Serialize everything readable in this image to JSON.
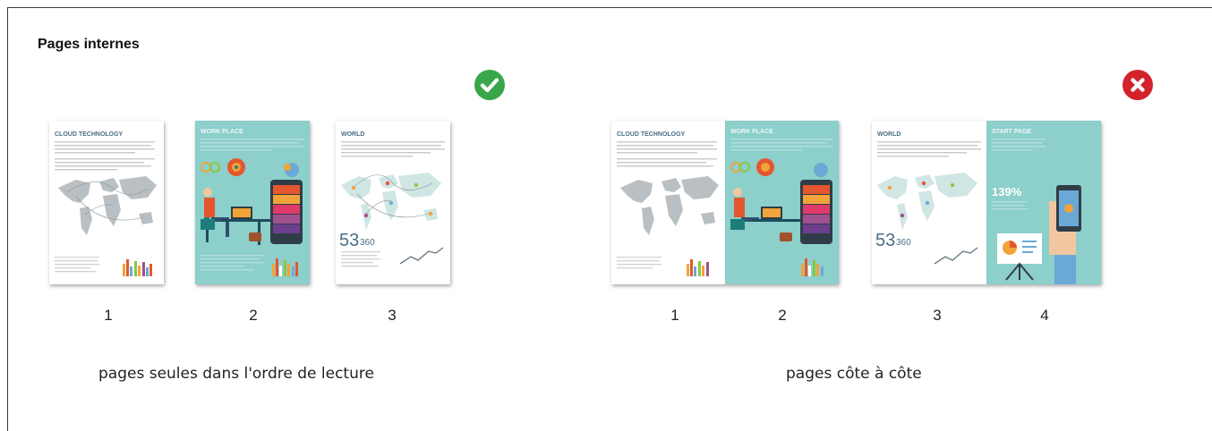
{
  "section": {
    "title": "Pages internes"
  },
  "good_example": {
    "icon": "check-circle-icon",
    "icon_color": "#3aa64a",
    "pages": [
      {
        "number": "1",
        "title": "CLOUD TECHNOLOGY"
      },
      {
        "number": "2",
        "title": "WORK PLACE"
      },
      {
        "number": "3",
        "title": "WORLD",
        "stat": "53",
        "stat_sub": "360"
      }
    ],
    "caption": "pages seules dans l'ordre de lecture"
  },
  "bad_example": {
    "icon": "cross-circle-icon",
    "icon_color": "#d3222a",
    "pages": [
      {
        "number": "1",
        "title": "CLOUD TECHNOLOGY"
      },
      {
        "number": "2",
        "title": "WORK PLACE"
      },
      {
        "number": "3",
        "title": "WORLD",
        "stat": "53",
        "stat_sub": "360"
      },
      {
        "number": "4",
        "title": "START PAGE",
        "stat": "139%"
      }
    ],
    "caption": "pages côte à côte"
  },
  "colors": {
    "teal": "#8ccfcb",
    "dark_teal": "#5fb0ad"
  }
}
